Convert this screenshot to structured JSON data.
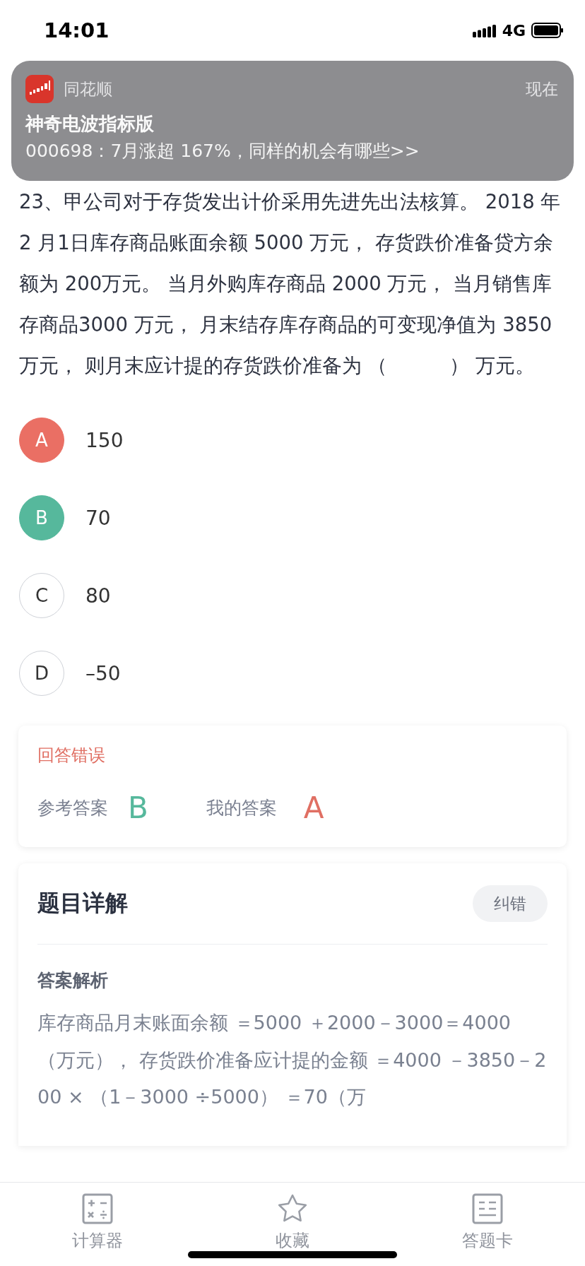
{
  "status_bar": {
    "time": "14:01",
    "network": "4G"
  },
  "notification": {
    "app": "同花顺",
    "time": "现在",
    "title": "神奇电波指标版",
    "body": "000698：7月涨超 167%，同样的机会有哪些>>"
  },
  "question": {
    "text": "23、甲公司对于存货发出计价采用先进先出法核算。 2018 年 2 月1日库存商品账面余额 5000 万元， 存货跌价准备贷方余额为 200万元。 当月外购库存商品 2000 万元， 当月销售库存商品3000 万元， 月末结存库存商品的可变现净值为 3850万元， 则月末应计提的存货跌价准备为 （          ） 万元。"
  },
  "options": [
    {
      "letter": "A",
      "text": "150",
      "kind": "wrong"
    },
    {
      "letter": "B",
      "text": "70",
      "kind": "correct"
    },
    {
      "letter": "C",
      "text": "80",
      "kind": "plain"
    },
    {
      "letter": "D",
      "text": "–50",
      "kind": "plain"
    }
  ],
  "result": {
    "status": "回答错误",
    "reference_label": "参考答案",
    "reference_answer": "B",
    "my_label": "我的答案",
    "my_answer": "A"
  },
  "detail": {
    "title": "题目详解",
    "report_button": "纠错",
    "section": "答案解析",
    "explanation": "库存商品月末账面余额 ＝5000 ＋2000－3000＝4000 （万元）， 存货跌价准备应计提的金额 ＝4000 －3850－200 × （1－3000 ÷5000） ＝70（万"
  },
  "tab_bar": [
    {
      "kind": "calculator",
      "label": "计算器"
    },
    {
      "kind": "star",
      "label": "收藏"
    },
    {
      "kind": "sheet",
      "label": "答题卡"
    }
  ]
}
